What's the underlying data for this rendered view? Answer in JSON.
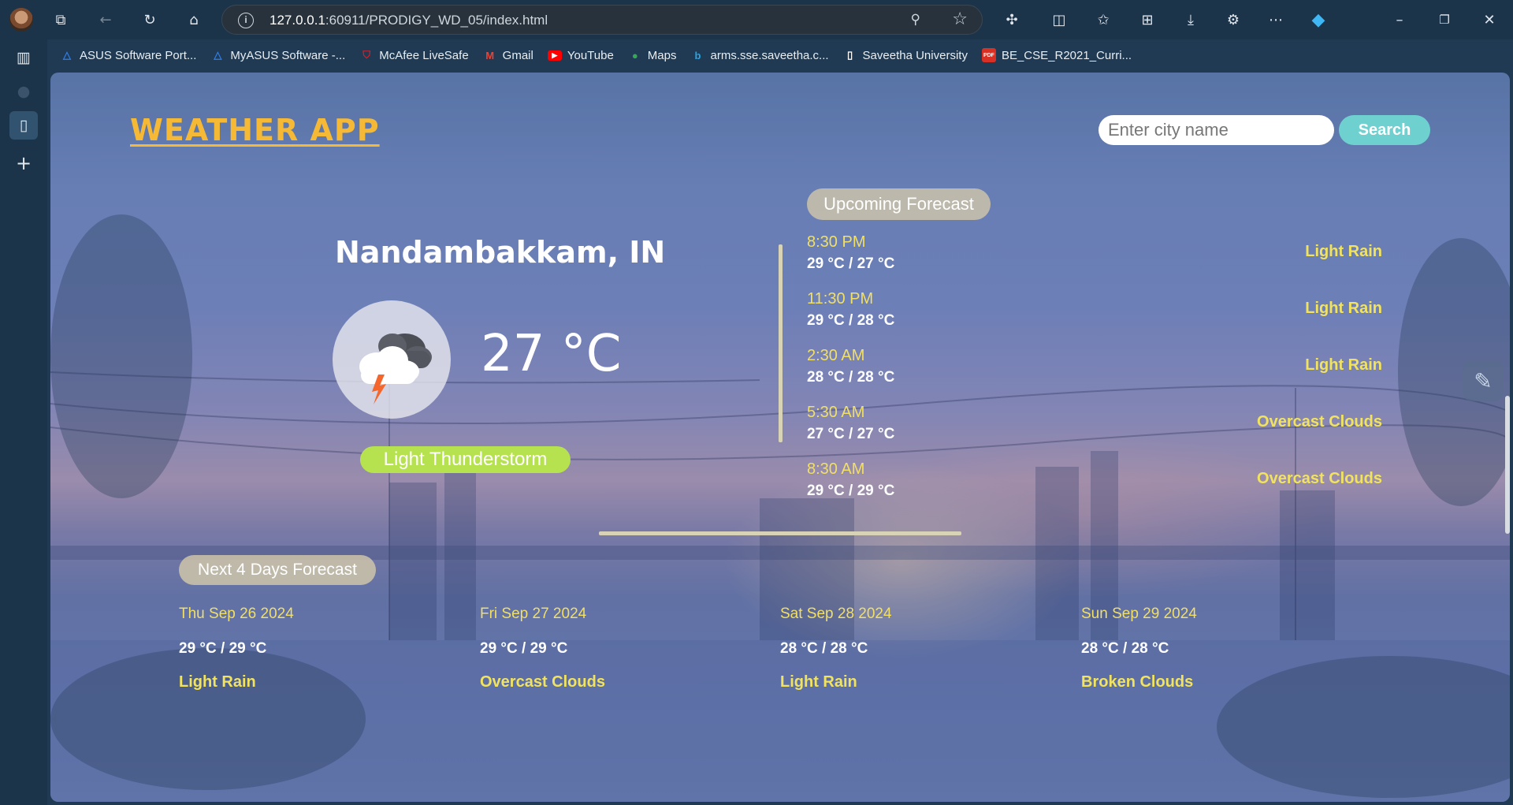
{
  "browser": {
    "url_host": "127.0.0.1",
    "url_rest": ":60911/PRODIGY_WD_05/index.html",
    "bookmarks": [
      {
        "label": "ASUS Software Port...",
        "icon": "asus-icon",
        "color": "#2f7ee8"
      },
      {
        "label": "MyASUS Software -...",
        "icon": "asus-icon",
        "color": "#2f7ee8"
      },
      {
        "label": "McAfee LiveSafe",
        "icon": "mcafee-icon",
        "color": "#d0232e"
      },
      {
        "label": "Gmail",
        "icon": "gmail-icon",
        "color": "#ea4335"
      },
      {
        "label": "YouTube",
        "icon": "youtube-icon",
        "color": "#ff0000"
      },
      {
        "label": "Maps",
        "icon": "maps-icon",
        "color": "#34a853"
      },
      {
        "label": "arms.sse.saveetha.c...",
        "icon": "bing-icon",
        "color": "#2aa3e3"
      },
      {
        "label": "Saveetha University",
        "icon": "page-icon",
        "color": "#ffffff"
      },
      {
        "label": "BE_CSE_R2021_Curri...",
        "icon": "pdf-icon",
        "color": "#d93025"
      }
    ]
  },
  "app": {
    "title": "WEATHER APP",
    "search": {
      "placeholder": "Enter city name",
      "button": "Search"
    },
    "current": {
      "city": "Nandambakkam, IN",
      "temp": "27 °C",
      "description": "Light Thunderstorm",
      "icon": "thunderstorm-cloud-icon"
    },
    "upcoming": {
      "heading": "Upcoming Forecast",
      "items": [
        {
          "time": "8:30 PM",
          "temps": "29 °C / 27 °C",
          "desc": "Light Rain"
        },
        {
          "time": "11:30 PM",
          "temps": "29 °C / 28 °C",
          "desc": "Light Rain"
        },
        {
          "time": "2:30 AM",
          "temps": "28 °C / 28 °C",
          "desc": "Light Rain"
        },
        {
          "time": "5:30 AM",
          "temps": "27 °C / 27 °C",
          "desc": "Overcast Clouds"
        },
        {
          "time": "8:30 AM",
          "temps": "29 °C / 29 °C",
          "desc": "Overcast Clouds"
        }
      ]
    },
    "daily": {
      "heading": "Next 4 Days Forecast",
      "items": [
        {
          "date": "Thu Sep 26 2024",
          "temps": "29 °C / 29 °C",
          "desc": "Light Rain"
        },
        {
          "date": "Fri Sep 27 2024",
          "temps": "29 °C / 29 °C",
          "desc": "Overcast Clouds"
        },
        {
          "date": "Sat Sep 28 2024",
          "temps": "28 °C / 28 °C",
          "desc": "Light Rain"
        },
        {
          "date": "Sun Sep 29 2024",
          "temps": "28 °C / 28 °C",
          "desc": "Broken Clouds"
        }
      ]
    },
    "colors": {
      "title": "#f5b935",
      "accent_yellow": "#f1e360",
      "badge_green": "#b6e24f",
      "search_button": "#6fd0d0"
    }
  }
}
